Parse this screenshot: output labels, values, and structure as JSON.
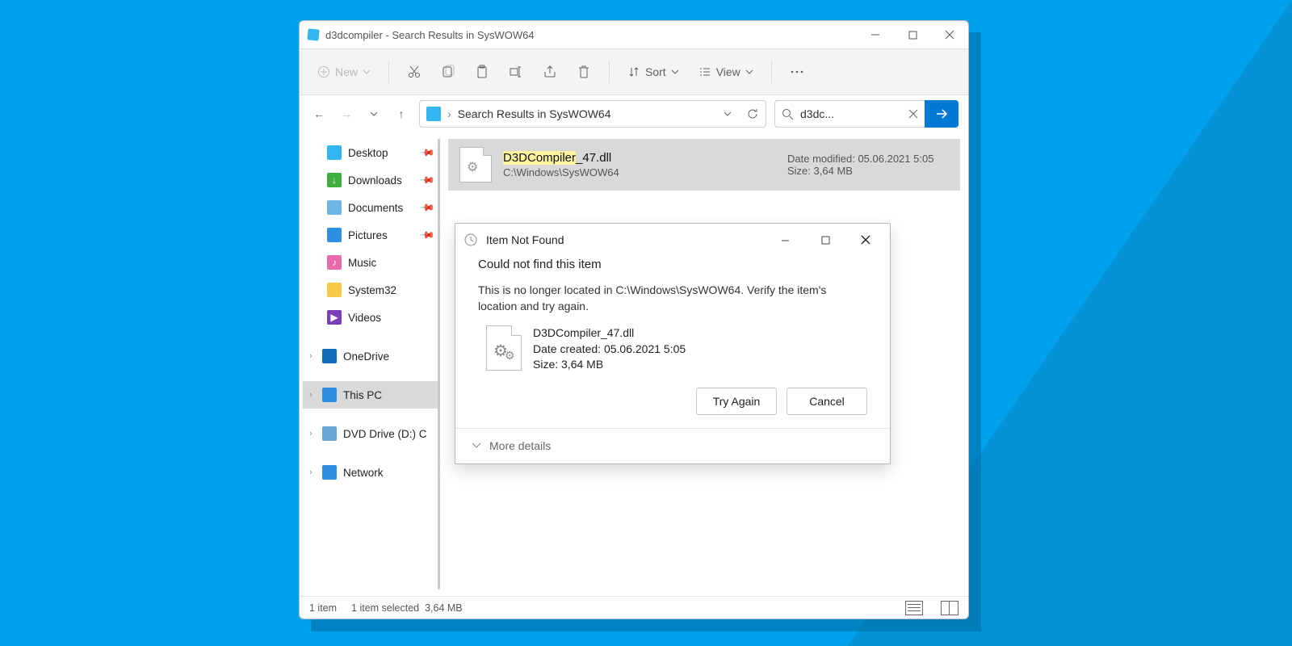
{
  "window": {
    "title": "d3dcompiler - Search Results in SysWOW64"
  },
  "toolbar": {
    "new_label": "New",
    "sort_label": "Sort",
    "view_label": "View"
  },
  "address": {
    "path": "Search Results in SysWOW64"
  },
  "search": {
    "query": "d3dc..."
  },
  "sidebar": {
    "items": [
      {
        "label": "Desktop",
        "pinned": true,
        "ico_bg": "#33b5f2"
      },
      {
        "label": "Downloads",
        "pinned": true,
        "ico_bg": "#3fae3f",
        "glyph": "↓"
      },
      {
        "label": "Documents",
        "pinned": true,
        "ico_bg": "#6fb6e6"
      },
      {
        "label": "Pictures",
        "pinned": true,
        "ico_bg": "#2f8fe0"
      },
      {
        "label": "Music",
        "pinned": false,
        "ico_bg": "#e96aa8",
        "glyph": "♪"
      },
      {
        "label": "System32",
        "pinned": false,
        "ico_bg": "#f7c948"
      },
      {
        "label": "Videos",
        "pinned": false,
        "ico_bg": "#7a3fb8",
        "glyph": "▶"
      }
    ],
    "groups": [
      {
        "label": "OneDrive",
        "ico_bg": "#0f6cbd"
      },
      {
        "label": "This PC",
        "ico_bg": "#2f8fe0",
        "selected": true
      },
      {
        "label": "DVD Drive (D:) C",
        "ico_bg": "#6aa6d8"
      },
      {
        "label": "Network",
        "ico_bg": "#2f8fe0"
      }
    ]
  },
  "file": {
    "name_hi": "D3DCompiler",
    "name_rest": "_47.dll",
    "path": "C:\\Windows\\SysWOW64",
    "modified_label": "Date modified:",
    "modified": "05.06.2021 5:05",
    "size_label": "Size:",
    "size": "3,64 MB"
  },
  "dialog": {
    "title": "Item Not Found",
    "heading": "Could not find this item",
    "message": "This is no longer located in C:\\Windows\\SysWOW64. Verify the item's location and try again.",
    "file_name": "D3DCompiler_47.dll",
    "created_label": "Date created:",
    "created": "05.06.2021 5:05",
    "size_label": "Size:",
    "size": "3,64 MB",
    "try_again": "Try Again",
    "cancel": "Cancel",
    "more_details": "More details"
  },
  "status": {
    "count": "1 item",
    "selected": "1 item selected",
    "size": "3,64 MB"
  }
}
